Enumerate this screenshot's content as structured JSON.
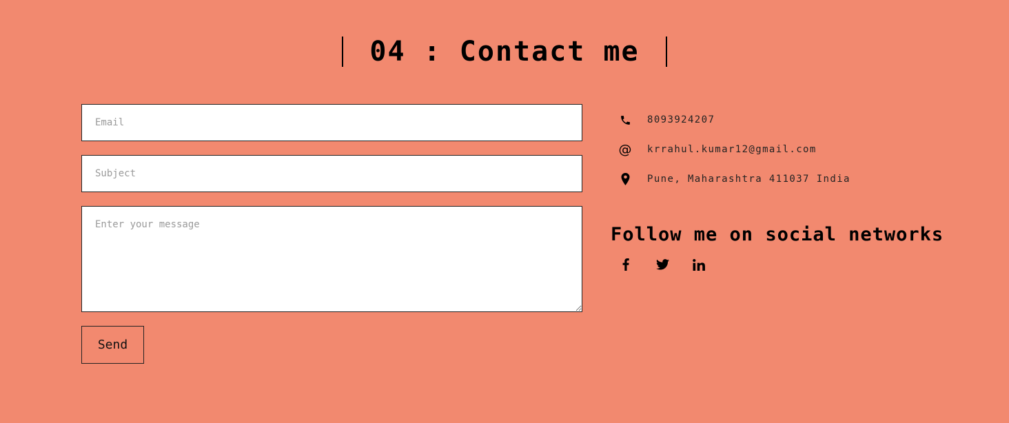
{
  "header": {
    "title": "04 : Contact me"
  },
  "form": {
    "email_placeholder": "Email",
    "subject_placeholder": "Subject",
    "message_placeholder": "Enter your message",
    "send_label": "Send"
  },
  "contact": {
    "phone": "8093924207",
    "email": "krrahul.kumar12@gmail.com",
    "address": "Pune, Maharashtra 411037 India",
    "at_symbol": "@"
  },
  "social": {
    "title": "Follow me on social networks",
    "icons": [
      "facebook-icon",
      "twitter-icon",
      "linkedin-icon"
    ]
  },
  "colors": {
    "background": "#f2896f",
    "field_background": "#ffffff",
    "text": "#000000"
  }
}
